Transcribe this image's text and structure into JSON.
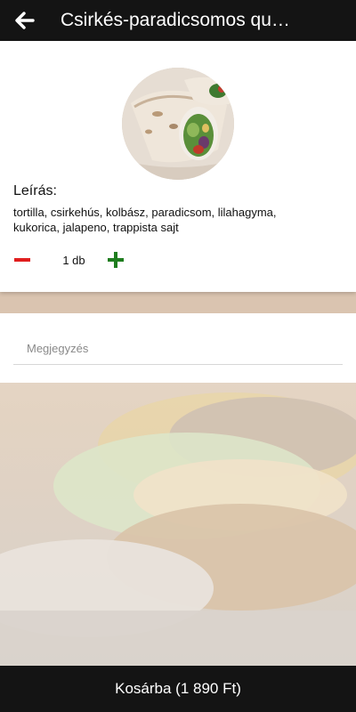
{
  "header": {
    "title": "Csirkés-paradicsomos qu…"
  },
  "product": {
    "description_heading": "Leírás:",
    "description": "tortilla, csirkehús, kolbász, paradicsom, lilahagyma, kukorica, jalapeno, trappista sajt",
    "quantity": "1 db"
  },
  "note": {
    "placeholder": "Megjegyzés"
  },
  "cart": {
    "label": "Kosárba (1 890 Ft)"
  },
  "colors": {
    "header_bg": "#141414",
    "minus": "#e01e1e",
    "plus": "#1e7d1e"
  },
  "icons": {
    "back": "arrow-left-icon",
    "minus": "minus-icon",
    "plus": "plus-icon"
  }
}
